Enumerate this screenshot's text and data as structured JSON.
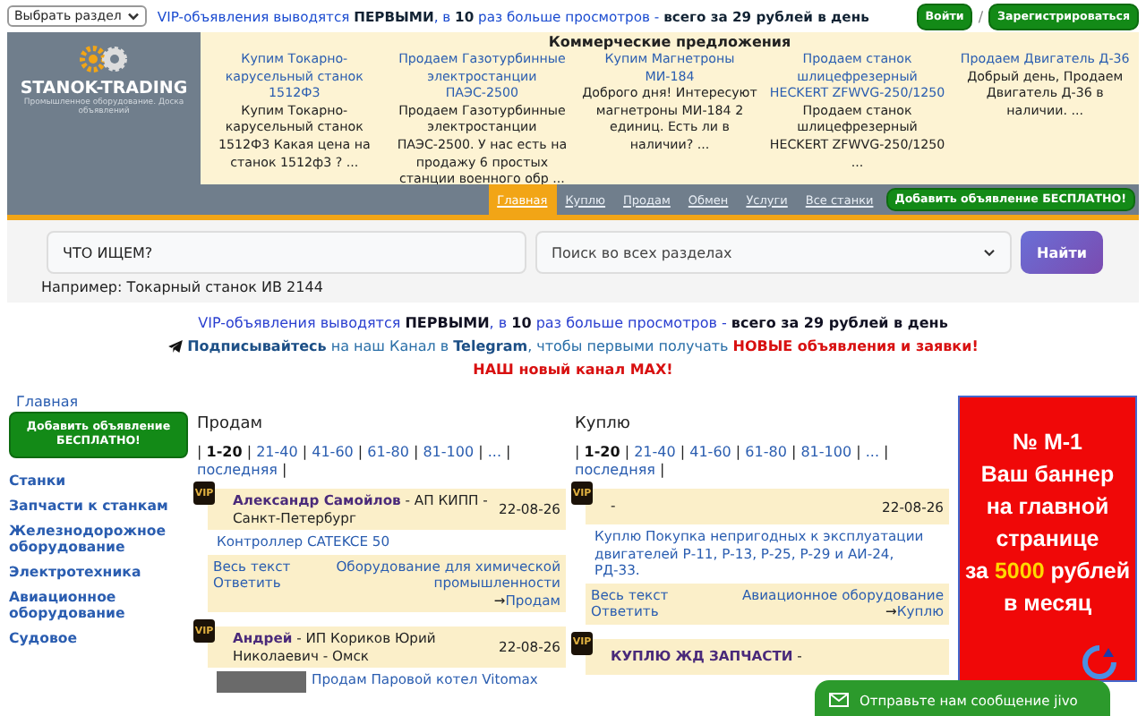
{
  "top_bar": {
    "section_select": "Выбрать раздел",
    "vip_notice": "VIP-объявления выводятся **ПЕРВЫМИ**, в **10** раз больше просмотров - **всего за 29 рублей в день**",
    "login_button": "Войти",
    "separator": "/",
    "register_button": "Зарегистрироваться"
  },
  "logo": {
    "name": "STANOK-TRADING",
    "tagline": "Промышленное оборудование. Доска объявлений"
  },
  "offers": {
    "title": "Коммерческие предложения",
    "items": [
      {
        "link": "Купим Токарно-карусельный станок 1512Ф3",
        "text": "Купим Токарно-карусельный станок 1512Ф3 Какая цена на станок 1512ф3 ? ..."
      },
      {
        "link": "Продаем Газотурбинные электростанции ПАЭС-2500",
        "text": "Продаем Газотурбинные электростанции ПАЭС-2500. У нас есть на продажу 6 простых станции военного обр ..."
      },
      {
        "link": "Купим Магнетроны МИ-184",
        "text": "Доброго дня! Интересуют магнетроны МИ-184 2 единиц. Есть ли в наличии? ..."
      },
      {
        "link": "Продаем станок шлицефрезерный HECKERT ZFWVG-250/1250",
        "text": "Продаем станок шлицефрезерный HECKERT ZFWVG-250/1250 ..."
      },
      {
        "link": "Продаем Двигатель Д-36",
        "text": "Добрый день, Продаем Двигатель Д-36 в наличии. ..."
      }
    ]
  },
  "nav": {
    "items": [
      {
        "label": "Главная",
        "selected": true
      },
      {
        "label": "Куплю",
        "selected": false
      },
      {
        "label": "Продам",
        "selected": false
      },
      {
        "label": "Обмен",
        "selected": false
      },
      {
        "label": "Услуги",
        "selected": false
      },
      {
        "label": "Все станки",
        "selected": false
      }
    ],
    "add_button": "Добавить объявление БЕСПЛАТНО!"
  },
  "search": {
    "placeholder": "ЧТО ИЩЕМ?",
    "scope": "Поиск во всех разделах",
    "button": "Найти",
    "example": "Например: Токарный станок ИВ 2144"
  },
  "notices": [
    {
      "kind": "vip",
      "text": "VIP-объявления выводятся **ПЕРВЫМИ**, в **10** раз больше просмотров - **всего за 29 рублей в день**"
    },
    {
      "kind": "telegram",
      "text": "**Подписывайтесь** на наш Канал в **Telegram**, чтобы первыми получать **НОВЫЕ объявления и заявки!**"
    },
    {
      "kind": "max",
      "text": "НАШ новый канал MAX!"
    }
  ],
  "breadcrumb": "Главная",
  "sidebar": {
    "add_button": "Добавить объявление БЕСПЛАТНО!",
    "categories": [
      "Станки",
      "Запчасти к станкам",
      "Железнодорожное оборудование",
      "Электротехника",
      "Авиационное оборудование",
      "Судовое"
    ]
  },
  "columns": [
    {
      "title": "Продам",
      "separator": "|",
      "pages": [
        {
          "label": "1-20",
          "selected": true
        },
        {
          "label": "21-40",
          "selected": false
        },
        {
          "label": "41-60",
          "selected": false
        },
        {
          "label": "61-80",
          "selected": false
        },
        {
          "label": "81-100",
          "selected": false
        },
        {
          "label": "...",
          "selected": false
        },
        {
          "label": "последняя",
          "selected": false
        }
      ],
      "listings": [
        {
          "badge": "VIP",
          "author": "Александр Самойлов",
          "company": "- АП КИПП - Санкт-Петербург",
          "date": "22-08-26",
          "title": "Контроллер CATEKCE 50",
          "more": "Весь текст",
          "reply": "Ответить",
          "category": "Оборудование для химической промышленности",
          "arrow": "→",
          "type": "Продам"
        },
        {
          "badge": "VIP",
          "author": "Андрей",
          "company": "- ИП Кориков Юрий Николаевич - Омск",
          "date": "22-08-26",
          "photo": true,
          "title": "Продам Паровой котел Vitomax"
        }
      ]
    },
    {
      "title": "Куплю",
      "separator": "|",
      "pages": [
        {
          "label": "1-20",
          "selected": true
        },
        {
          "label": "21-40",
          "selected": false
        },
        {
          "label": "41-60",
          "selected": false
        },
        {
          "label": "61-80",
          "selected": false
        },
        {
          "label": "81-100",
          "selected": false
        },
        {
          "label": "...",
          "selected": false
        },
        {
          "label": "последняя",
          "selected": false
        }
      ],
      "listings": [
        {
          "badge": "VIP",
          "company": "-",
          "date": "22-08-26",
          "title": "Куплю Покупка непригодных к эксплуатации двигателей Р-11, Р-13, Р-25, Р-29 и АИ-24, РД-33.",
          "more": "Весь текст",
          "reply": "Ответить",
          "category": "Авиационное оборудование",
          "arrow": "→",
          "type": "Куплю"
        },
        {
          "badge": "VIP",
          "author": "КУПЛЮ ЖД ЗАПЧАСТИ",
          "company": "-"
        }
      ]
    }
  ],
  "banner": {
    "lines": [
      "№ М-1",
      "Ваш баннер",
      "на главной",
      "странице",
      "за **5000** рублей",
      "в месяц"
    ]
  },
  "chat": {
    "label": "Отправьте нам сообщение",
    "brand": "jivo"
  }
}
